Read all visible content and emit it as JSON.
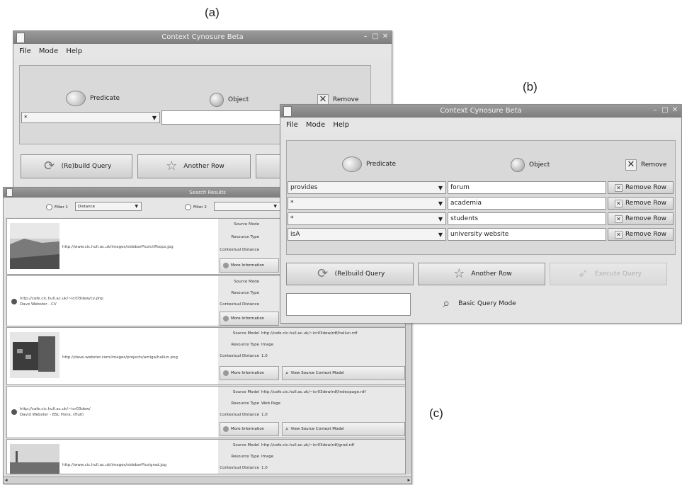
{
  "labels": {
    "a": "(a)",
    "b": "(b)",
    "c": "(c)"
  },
  "window_a": {
    "title": "Context Cynosure Beta",
    "menu": [
      "File",
      "Mode",
      "Help"
    ],
    "headers": {
      "predicate": "Predicate",
      "object": "Object",
      "remove": "Remove"
    },
    "row_predicate": "*",
    "rebuild": "(Re)build Query",
    "another_row": "Another Row"
  },
  "window_b": {
    "title": "Context Cynosure Beta",
    "menu": [
      "File",
      "Mode",
      "Help"
    ],
    "headers": {
      "predicate": "Predicate",
      "object": "Object",
      "remove": "Remove"
    },
    "rows": [
      {
        "predicate": "provides",
        "object": "forum",
        "remove": "Remove Row"
      },
      {
        "predicate": "*",
        "object": "academia",
        "remove": "Remove Row"
      },
      {
        "predicate": "*",
        "object": "students",
        "remove": "Remove Row"
      },
      {
        "predicate": "isA",
        "object": "university website",
        "remove": "Remove Row"
      }
    ],
    "rebuild": "(Re)build Query",
    "another_row": "Another Row",
    "execute": "Execute Query",
    "basic_mode": "Basic Query Mode"
  },
  "window_c": {
    "title": "Search Results",
    "filter1": "Filter 1",
    "filter1_value": "Distance",
    "filter2": "Filter 2",
    "more_info": "More Information",
    "view_source": "View Source Context Model",
    "results": [
      {
        "text1": "http://www.cic.hull.ac.uk/images/sidebarPics/cliffsops.jpg",
        "text2": "",
        "source_model_label": "Source Mode",
        "source_model": "",
        "resource_type_label": "Resource Type",
        "resource_type": "",
        "distance_label": "Contextual Distance",
        "distance": ""
      },
      {
        "text1": "http://cafe.cic.hull.ac.uk/~icr03dew/cv.php",
        "text2": "Dave Webster - CV",
        "source_model_label": "Source Mode",
        "source_model": "",
        "resource_type_label": "Resource Type",
        "resource_type": "",
        "distance_label": "Contextual Distance",
        "distance": ""
      },
      {
        "text1": "http://dave-webster.com/images/projects/amiga/hallun.png",
        "text2": "",
        "source_model_label": "Source Model",
        "source_model": "http://cafe.cic.hull.ac.uk/~icr03dew/rdf/hallun.rdf",
        "resource_type_label": "Resource Type",
        "resource_type": "Image",
        "distance_label": "Contextual Distance",
        "distance": "1.0"
      },
      {
        "text1": "http://cafe.cic.hull.ac.uk/~icr03dew/",
        "text2": "David Webster - BSc Hons. (Hull)",
        "source_model_label": "Source Model",
        "source_model": "http://cafe.cic.hull.ac.uk/~icr03dew/rdf/indexpage.rdf",
        "resource_type_label": "Resource Type",
        "resource_type": "Web Page",
        "distance_label": "Contextual Distance",
        "distance": "1.0"
      },
      {
        "text1": "http://www.cic.hull.ac.uk/images/sidebarPics/grad.jpg",
        "text2": "",
        "source_model_label": "Source Model",
        "source_model": "http://cafe.cic.hull.ac.uk/~icr03dew/rdf/grad.rdf",
        "resource_type_label": "Resource Type",
        "resource_type": "Image",
        "distance_label": "Contextual Distance",
        "distance": "1.0"
      }
    ]
  }
}
